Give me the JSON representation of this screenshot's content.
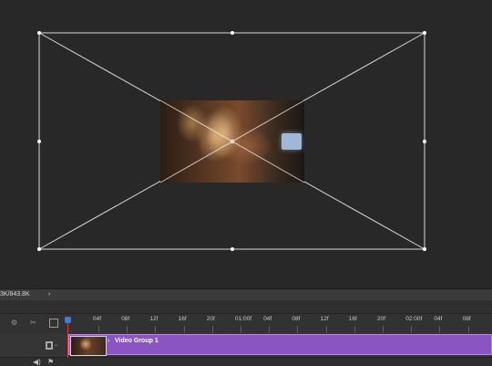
{
  "status_bar": {
    "doc_size": "3K/843.8K",
    "arrow": "›"
  },
  "timeline": {
    "ruler_labels": [
      "04f",
      "08f",
      "12f",
      "16f",
      "20f",
      "01:00f",
      "04f",
      "08f",
      "12f",
      "16f",
      "20f",
      "02:00f",
      "04f",
      "08f"
    ],
    "controls": {
      "gear_icon": "⚙",
      "scissors_icon": "✂"
    }
  },
  "track": {
    "clip_label": "Video Group 1",
    "clip_chevron": "›",
    "clip_color": "#8a55c3",
    "header_chevron": "⌄"
  },
  "bottom": {
    "audio_icon": "◀)",
    "flag_icon": "⚑"
  }
}
